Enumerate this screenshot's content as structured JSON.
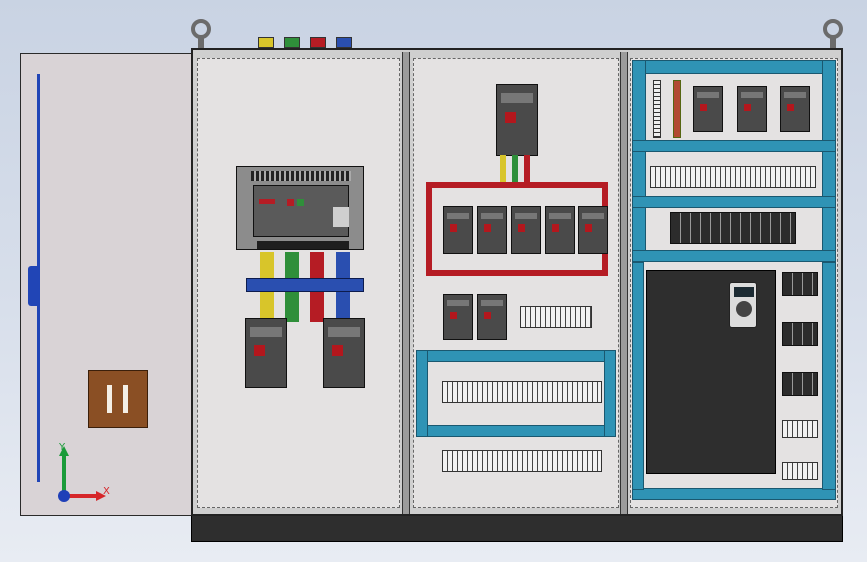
{
  "axis": {
    "y_label": "Y",
    "x_label": "X"
  },
  "colors": {
    "busbar_red": "#b51c24",
    "busbar_yellow": "#d8c52a",
    "busbar_green": "#2f8f3a",
    "busbar_blue": "#2a4fb0",
    "rail_teal": "#2f93b5",
    "door_panel": "#dcd6d8",
    "plinth": "#2e2e2e"
  },
  "icons": {
    "lifting_eye_left": "lifting-eye-icon",
    "lifting_eye_right": "lifting-eye-icon",
    "axis_triad": "axis-triad-icon"
  }
}
